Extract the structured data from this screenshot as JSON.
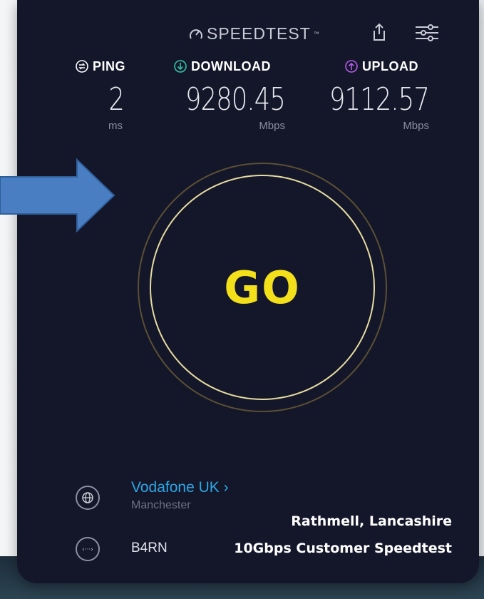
{
  "header": {
    "brand": "SPEEDTEST",
    "brand_tm": "™",
    "share_icon": "share-icon",
    "settings_icon": "settings-sliders-icon"
  },
  "metrics": {
    "ping": {
      "label": "PING",
      "value": "2",
      "unit": "ms",
      "icon": "ping-icon"
    },
    "download": {
      "label": "DOWNLOAD",
      "value": "9280.45",
      "unit": "Mbps",
      "icon": "download-arrow-icon",
      "color": "#2fc7a6"
    },
    "upload": {
      "label": "UPLOAD",
      "value": "9112.57",
      "unit": "Mbps",
      "icon": "upload-arrow-icon",
      "color": "#b45ee8"
    }
  },
  "go_button": {
    "label": "GO",
    "color": "#f3df1a"
  },
  "provider": {
    "name": "Vodafone UK ›",
    "location": "Manchester",
    "icon": "globe-icon"
  },
  "server": {
    "name": "B4RN",
    "icon": "server-connection-icon"
  },
  "caption": {
    "line1": "Rathmell, Lancashire",
    "line2": "10Gbps Customer Speedtest"
  },
  "annotation": {
    "icon": "arrow-right-icon",
    "color": "#4a7ec2"
  }
}
